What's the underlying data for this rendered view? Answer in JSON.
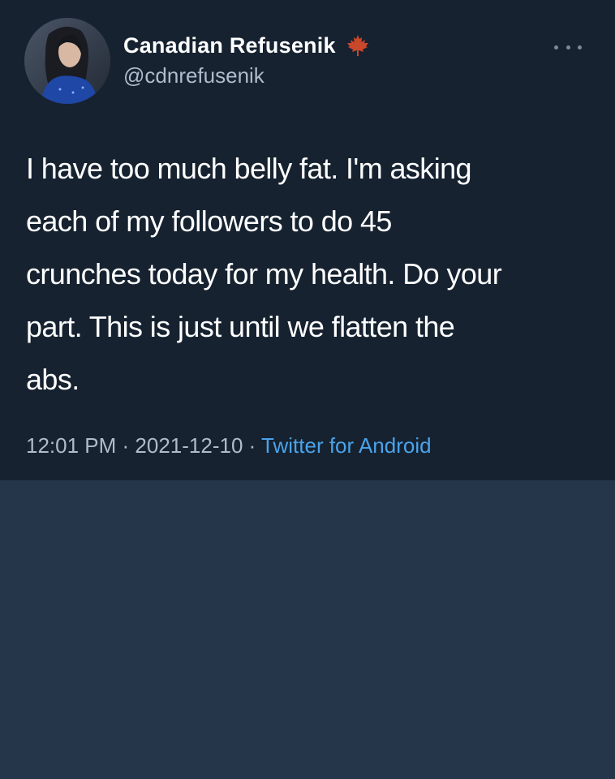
{
  "user": {
    "display_name": "Canadian Refusenik",
    "handle": "@cdnrefusenik",
    "badge_icon": "maple-leaf-icon",
    "avatar": "avatar"
  },
  "tweet": {
    "lines": [
      "I have too much belly fat. I'm asking",
      "each of my followers to do 45",
      "crunches today for my health. Do your",
      "part. This is just until we flatten the",
      "abs."
    ],
    "time": "12:01 PM",
    "separator": " · ",
    "date": "2021-12-10",
    "source": "Twitter for Android"
  },
  "icons": {
    "more": "more-options-icon"
  },
  "colors": {
    "tweet_bg": "#162230",
    "page_bg": "#26364a",
    "text": "#ffffff",
    "muted": "#aebccb",
    "link": "#4aa3ea",
    "leaf": "#c9472b"
  }
}
